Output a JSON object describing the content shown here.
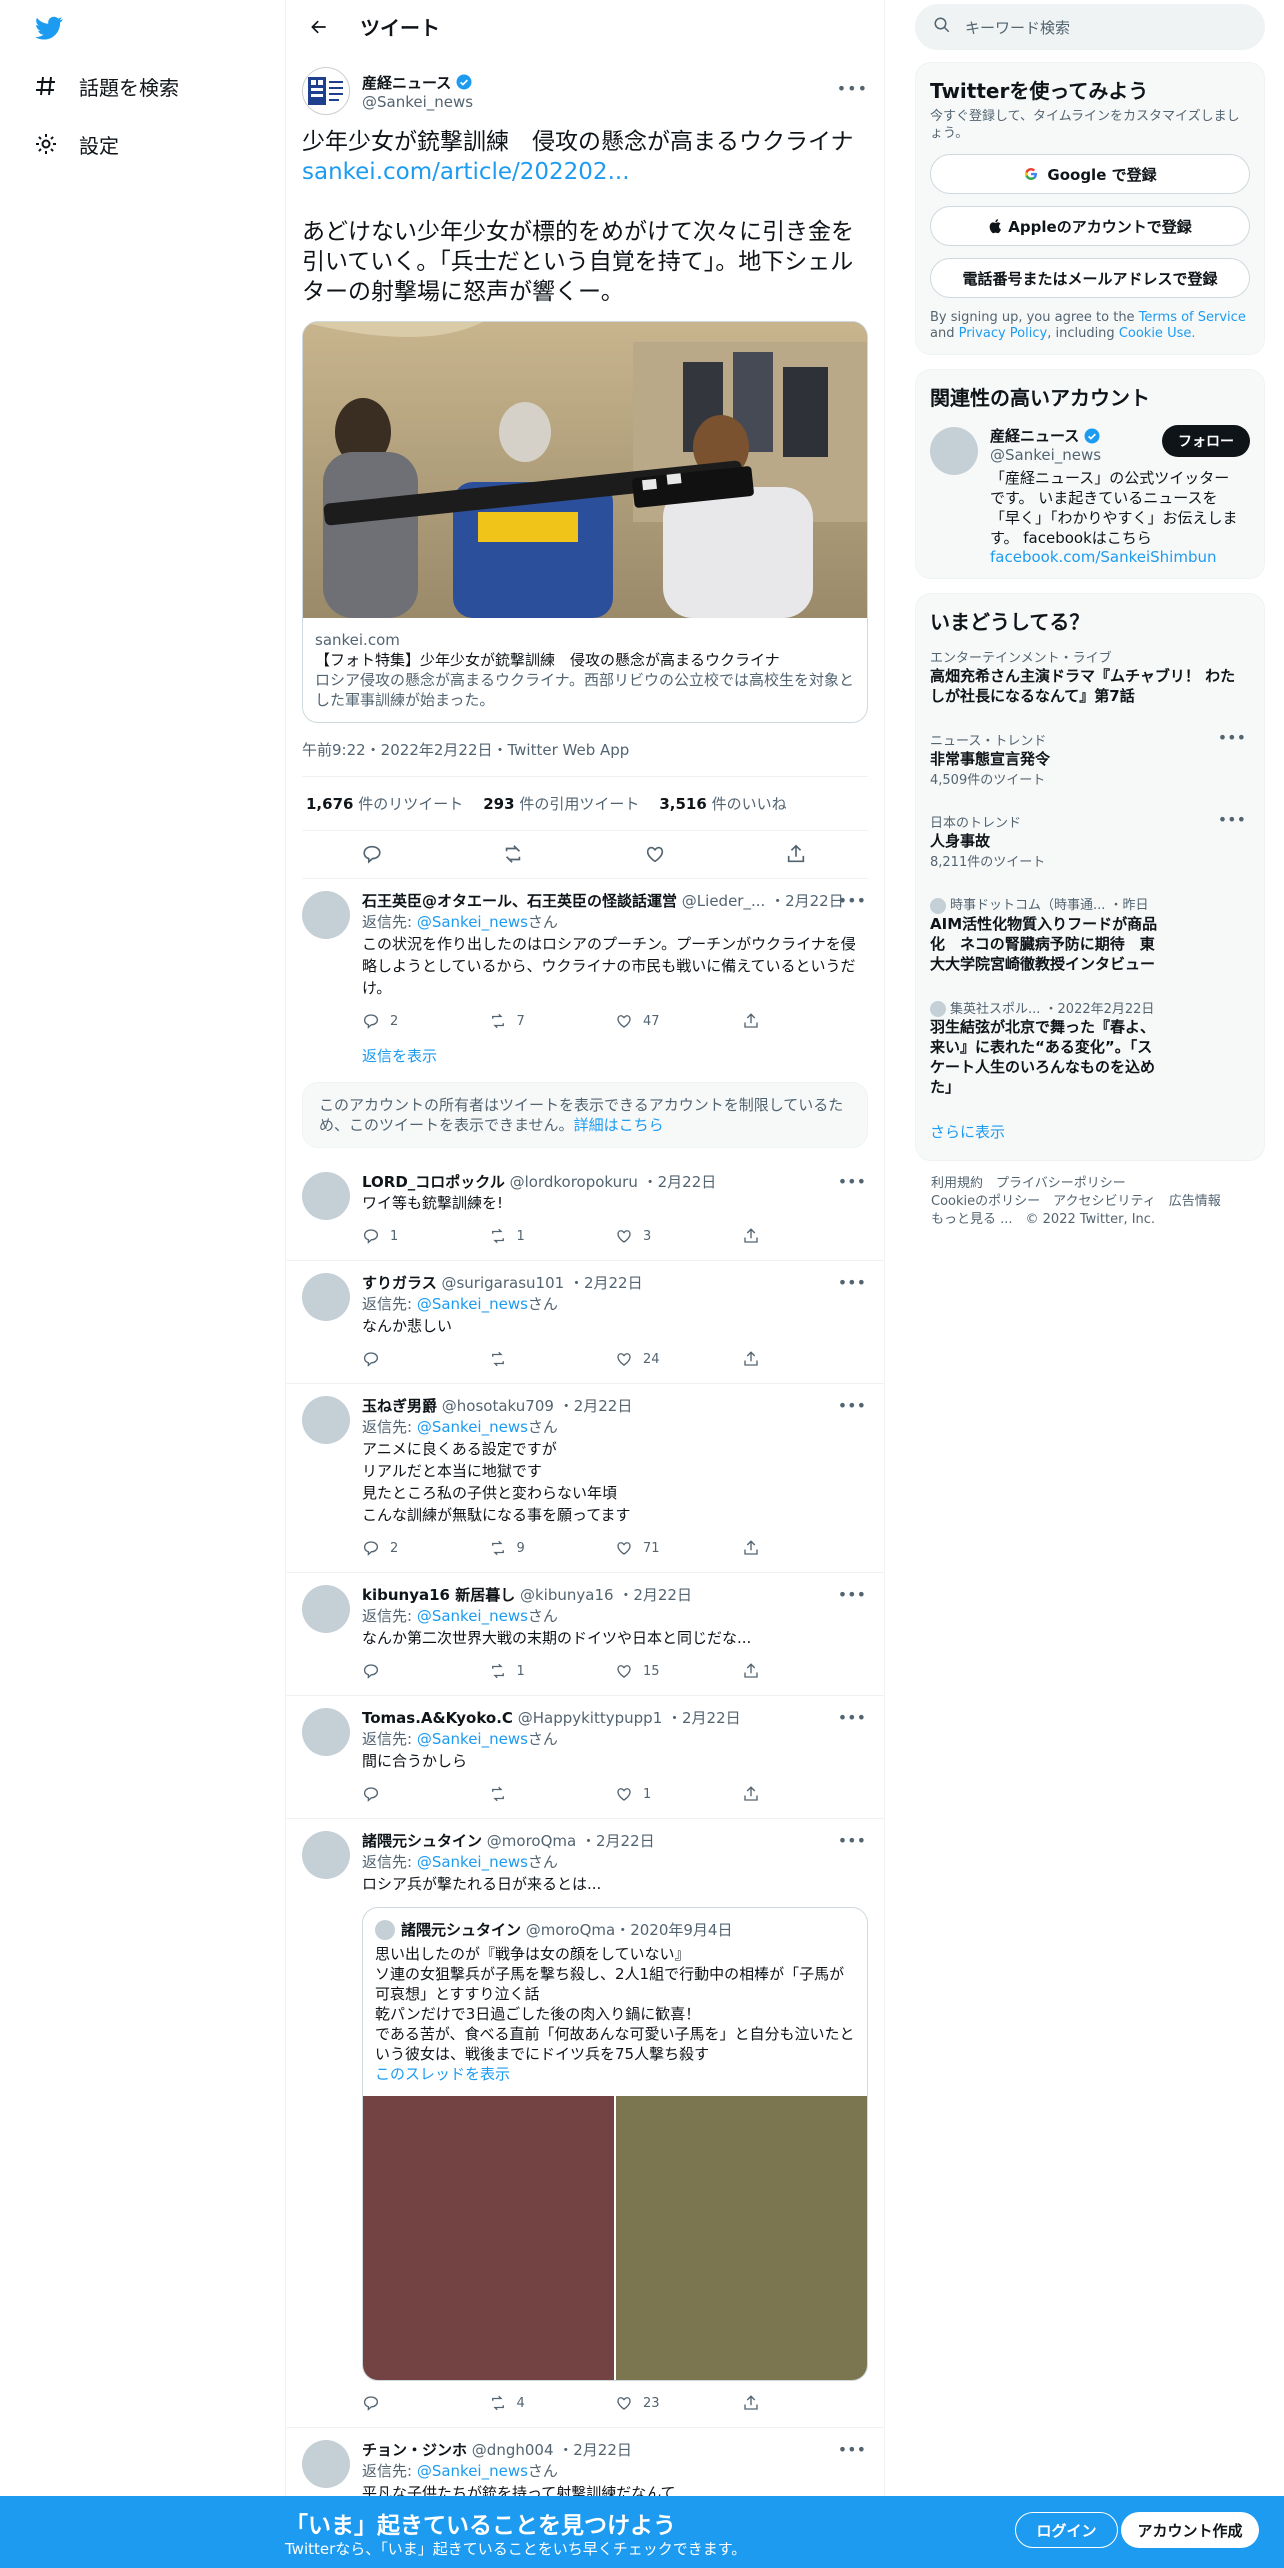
{
  "nav": {
    "explore": "話題を検索",
    "settings": "設定"
  },
  "header": {
    "title": "ツイート"
  },
  "tweet": {
    "author": "産経ニュース",
    "handle": "@Sankei_news",
    "headline": "少年少女が銃撃訓練　侵攻の懸念が高まるウクライナ",
    "link": "sankei.com/article/202202...",
    "body": "あどけない少年少女が標的をめがけて次々に引き金を引いていく。「兵士だという自覚を持て」。地下シェルターの射撃場に怒声が響くー。",
    "card_domain": "sankei.com",
    "card_title": "【フォト特集】少年少女が銃撃訓練　侵攻の懸念が高まるウクライナ",
    "card_desc": "ロシア侵攻の懸念が高まるウクライナ。西部リビウの公立校では高校生を対象とした軍事訓練が始まった。",
    "meta": "午前9:22・2022年2月22日・Twitter Web App",
    "retweets": "1,676",
    "retweets_label": "件のリツイート",
    "quotes": "293",
    "quotes_label": "件の引用ツイート",
    "likes": "3,516",
    "likes_label": "件のいいね"
  },
  "reply_prefix": "返信先: ",
  "reply_suffix": "さん",
  "show_replies": "返信を表示",
  "notice": {
    "text": "このアカウントの所有者はツイートを表示できるアカウントを制限しているため、このツイートを表示できません。",
    "link": "詳細はこちら"
  },
  "replies": [
    {
      "name": "石王英臣@オタエール、石王英臣の怪談話運営",
      "handle": "@Lieder_...",
      "date": "・2月22日",
      "to": "@Sankei_news",
      "text": "この状況を作り出したのはロシアのプーチン。プーチンがウクライナを侵略しようとしているから、ウクライナの市民も戦いに備えているというだけ。",
      "replies": "2",
      "rts": "7",
      "likes": "47"
    },
    {
      "name": "LORD_コロポックル",
      "handle": "@lordkoropokuru",
      "date": "・2月22日",
      "to": "",
      "text": "ワイ等も銃撃訓練を!",
      "replies": "1",
      "rts": "1",
      "likes": "3"
    },
    {
      "name": "すりガラス",
      "handle": "@surigarasu101",
      "date": "・2月22日",
      "to": "@Sankei_news",
      "text": "なんか悲しい",
      "replies": "",
      "rts": "",
      "likes": "24"
    },
    {
      "name": "玉ねぎ男爵",
      "handle": "@hosotaku709",
      "date": "・2月22日",
      "to": "@Sankei_news",
      "text": "アニメに良くある設定ですが\nリアルだと本当に地獄です\n見たところ私の子供と変わらない年頃\nこんな訓練が無駄になる事を願ってます",
      "replies": "2",
      "rts": "9",
      "likes": "71"
    },
    {
      "name": "kibunya16 新居暮し",
      "handle": "@kibunya16",
      "date": "・2月22日",
      "to": "@Sankei_news",
      "text": "なんか第二次世界大戦の末期のドイツや日本と同じだな...",
      "replies": "",
      "rts": "1",
      "likes": "15"
    },
    {
      "name": "Tomas.A&Kyoko.C",
      "handle": "@Happykittypupp1",
      "date": "・2月22日",
      "to": "@Sankei_news",
      "text": "間に合うかしら",
      "replies": "",
      "rts": "",
      "likes": "1"
    },
    {
      "name": "諸隈元シュタイン",
      "handle": "@moroQma",
      "date": "・2月22日",
      "to": "@Sankei_news",
      "text": "ロシア兵が撃たれる日が来るとは...",
      "replies": "",
      "rts": "4",
      "likes": "23"
    },
    {
      "name": "チョン・ジンホ",
      "handle": "@dngh004",
      "date": "・2月22日",
      "to": "@Sankei_news",
      "text": "平凡な子供たちが銃を持って射撃訓練だなんて",
      "replies": "",
      "rts": "",
      "likes": ""
    }
  ],
  "quote": {
    "name": "諸隈元シュタイン",
    "handle": "@moroQma",
    "date": "・2020年9月4日",
    "text": "思い出したのが『戦争は女の顔をしていない』\nソ連の女狙撃兵が子馬を撃ち殺し、2人1組で行動中の相棒が「子馬が可哀想」とすすり泣く話\n乾パンだけで3日過ごした後の肉入り鍋に歓喜！\nである苦が、食べる直前「何故あんな可愛い子馬を」と自分も泣いたという彼女は、戦後までにドイツ兵を75人撃ち殺す",
    "thread": "このスレッドを表示",
    "media_colors": [
      "#734242",
      "#7b7550"
    ]
  },
  "right": {
    "search_placeholder": "キーワード検索",
    "signup_title": "Twitterを使ってみよう",
    "signup_sub": "今すぐ登録して、タイムラインをカスタマイズしましょう。",
    "google_btn": "Google で登録",
    "apple_btn": "Appleのアカウントで登録",
    "phone_btn": "電話番号またはメールアドレスで登録",
    "terms_1": "By signing up, you agree to the ",
    "terms_link": "Terms of Service",
    "terms_2": " and ",
    "privacy_link": "Privacy Policy",
    "terms_3": ", including ",
    "cookie_link": "Cookie Use.",
    "related_title": "関連性の高いアカウント",
    "acct_name": "産経ニュース",
    "acct_handle": "@Sankei_news",
    "follow": "フォロー",
    "acct_bio": "「産経ニュース」の公式ツイッターです。 いま起きているニュースを「早く」「わかりやすく」お伝えします。 facebookはこちら",
    "acct_link": "facebook.com/SankeiShimbun",
    "trends_title": "いまどうしてる？",
    "trends": [
      {
        "cat": "エンターテインメント・ライブ",
        "name": "高畑充希さん主演ドラマ『ムチャブリ！ わたしが社長になるなんて』第7話",
        "count": ""
      },
      {
        "cat": "ニュース・トレンド",
        "name": "非常事態宣言発令",
        "count": "4,509件のツイート"
      },
      {
        "cat": "日本のトレンド",
        "name": "人身事故",
        "count": "8,211件のツイート"
      },
      {
        "cat": "時事ドットコム（時事通... ・昨日",
        "name": "AIM活性化物質入りフードが商品化　ネコの腎臓病予防に期待　東大大学院宮崎徹教授インタビュー",
        "count": ""
      },
      {
        "cat": "集英社スポル... ・2022年2月22日",
        "name": "羽生結弦が北京で舞った『春よ、来い』に表れた“ある変化”。「スケート人生のいろんなものを込めた」",
        "count": ""
      }
    ],
    "show_more": "さらに表示",
    "footer_1": "利用規約　プライバシーポリシー",
    "footer_2": "Cookieのポリシー　アクセシビリティ　広告情報",
    "footer_3": "もっと見る ...　© 2022 Twitter, Inc."
  },
  "bottom": {
    "title": "「いま」起きていることを見つけよう",
    "sub": "Twitterなら、「いま」起きていることをいち早くチェックできます。",
    "login": "ログイン",
    "signup": "アカウント作成"
  },
  "colors": {
    "accent": "#1d9bf0",
    "text": "#0f1419",
    "muted": "#536471"
  }
}
